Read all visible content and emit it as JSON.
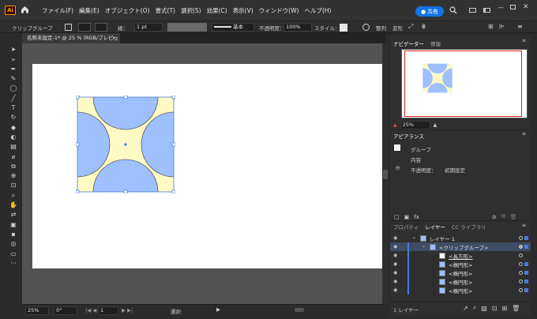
{
  "app": {
    "logo": "Ai",
    "share_label": "共有"
  },
  "menu": [
    "ファイル(F)",
    "編集(E)",
    "オブジェクト(O)",
    "書式(T)",
    "選択(S)",
    "効果(C)",
    "表示(V)",
    "ウィンドウ(W)",
    "ヘルプ(H)"
  ],
  "control_bar": {
    "selection_type": "クリップグループ",
    "stroke_label": "線：",
    "stroke_value": "1 pt",
    "brush_label": "基本",
    "opacity_label": "不透明度：",
    "opacity_value": "100%",
    "style_label": "スタイル：",
    "align_label": "整列",
    "transform_label": "変形"
  },
  "document_tab": {
    "title": "名称未設定-1* @ 25 % (RGB/プレビュー)",
    "close": "×"
  },
  "status_bar": {
    "zoom": "25%",
    "rotation": "0°",
    "artboard": "1",
    "tool": "選択"
  },
  "navigator": {
    "tabs": [
      "ナビゲーター",
      "情報"
    ],
    "zoom": "25%"
  },
  "appearance": {
    "title": "アピアランス",
    "object": "グループ",
    "contents": "内容",
    "opacity_label": "不透明度：",
    "opacity_value": "初期設定"
  },
  "layers_panel": {
    "tabs": [
      "プロパティ",
      "レイヤー",
      "CC ライブラリ"
    ],
    "layer": "レイヤー 1",
    "clip_group": "<クリップグループ>",
    "items": [
      "<長方形>",
      "<楕円形>",
      "<楕円形>",
      "<楕円形>",
      "<楕円形>"
    ],
    "footer_count": "1 レイヤー"
  },
  "colors": {
    "artwork_bg": "#fff9c4",
    "circle_fill": "#9ec0ff",
    "selection": "#4a7bdb",
    "accent": "#1473e6"
  }
}
